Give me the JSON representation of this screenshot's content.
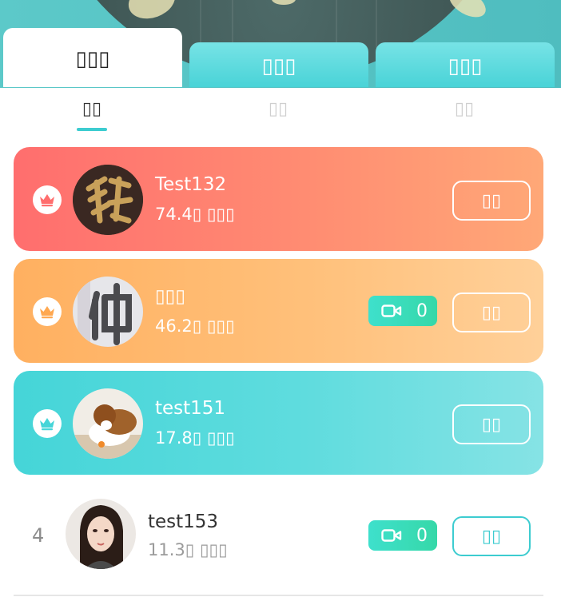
{
  "main_tabs": [
    {
      "label": "▯▯▯"
    },
    {
      "label": "▯▯▯"
    },
    {
      "label": "▯▯▯"
    }
  ],
  "sub_tabs": [
    {
      "label": "▯▯"
    },
    {
      "label": "▯▯"
    },
    {
      "label": "▯▯"
    }
  ],
  "ranking": [
    {
      "rank": "",
      "name": "Test132",
      "score": "74.4▯ ▯▯▯",
      "follow_label": "▯▯",
      "live_count": ""
    },
    {
      "rank": "",
      "name": "▯▯▯",
      "score": "46.2▯ ▯▯▯",
      "follow_label": "▯▯",
      "live_count": "0"
    },
    {
      "rank": "",
      "name": "test151",
      "score": "17.8▯ ▯▯▯",
      "follow_label": "▯▯",
      "live_count": ""
    },
    {
      "rank": "4",
      "name": "test153",
      "score": "11.3▯ ▯▯▯",
      "follow_label": "▯▯",
      "live_count": "0"
    }
  ],
  "colors": {
    "accent": "#3dccd0",
    "rank1": "#ff6e6e",
    "rank2": "#ffb060",
    "rank3": "#45d5d8",
    "live_badge": "#3ee0cc"
  },
  "icons": {
    "crown": "crown-icon",
    "live": "video-camera-icon"
  }
}
